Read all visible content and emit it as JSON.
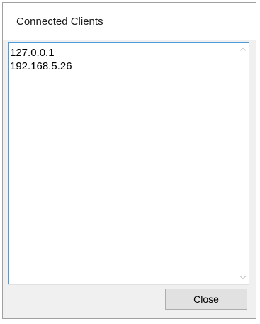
{
  "window": {
    "title": "Connected Clients"
  },
  "clients": {
    "lines": [
      "127.0.0.1",
      "192.168.5.26"
    ]
  },
  "footer": {
    "close_label": "Close"
  },
  "icons": {
    "scroll_up": "chevron-up-icon",
    "scroll_down": "chevron-down-icon"
  },
  "colors": {
    "text_area_border": "#4d9bd8",
    "dialog_background": "#f0f0f0",
    "button_background": "#e1e1e1"
  }
}
